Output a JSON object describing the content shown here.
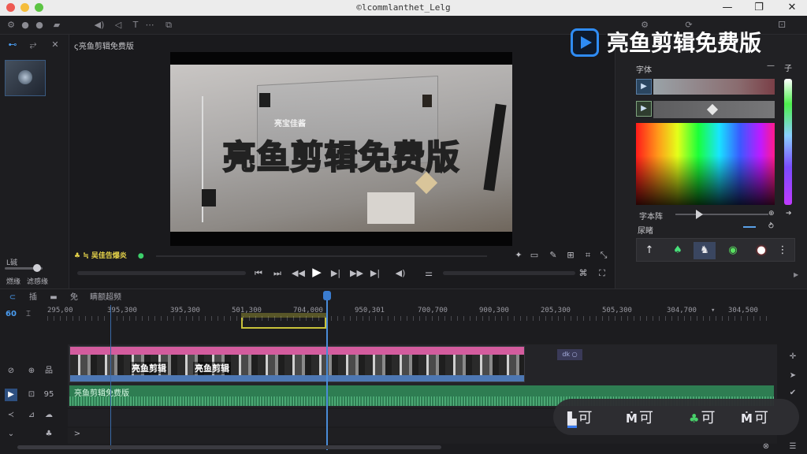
{
  "window": {
    "title": "©lcommlanthet_Lelg",
    "minimize": "—",
    "maximize": "❐",
    "close": "✕"
  },
  "brand": {
    "name": "亮鱼剪辑免费版"
  },
  "left_panel": {
    "tabs": [
      "⊷",
      "⥂",
      "✕"
    ],
    "label_1": "L碱",
    "label_2": "燃缘",
    "label_3": "滤感缘"
  },
  "preview": {
    "title": "ς亮鱼剪辑免费版",
    "caption": "亮鱼剪辑免费版",
    "board_text": "亮宝佳酱",
    "tags": "♣ ≒ 吴佳告爆炎",
    "controls": {
      "first": "⏮",
      "prev": "⏭",
      "rewind": "◀◀",
      "play": "▶",
      "next": "▶|",
      "fforward": "▶▶",
      "last": "▶|",
      "volume": "◀)",
      "settings": "⚌"
    }
  },
  "right_panel": {
    "font_label": "字体",
    "font_dash": "—",
    "font_icon": "子",
    "size_label": "字本阵",
    "style_label": "尿睹",
    "style_value": "─",
    "btn1": "▶",
    "btn2": "▶",
    "shapes": [
      "↑",
      "♠",
      "♞",
      "◉",
      "●",
      "⋮"
    ]
  },
  "timeline": {
    "toolbar": [
      "⊂",
      "插",
      "▬",
      "免",
      "瞒额超频"
    ],
    "zoom": "60",
    "ticks": [
      "295,00",
      "395,300",
      "395,300",
      "501,300",
      "704,000",
      "950,301",
      "700,700",
      "900,300",
      "205,300",
      "505,300",
      "304,700",
      "▾",
      "304,500"
    ],
    "video_clip_labels": [
      "亮鱼剪辑",
      "亮鱼剪辑"
    ],
    "small_clip": "dk ○",
    "audio_label": "亮鱼剪辑免费版",
    "track_icons": {
      "video": [
        "⊘",
        "⊕",
        "品"
      ],
      "audio": [
        "▶",
        "⊡",
        "95"
      ],
      "fx": [
        "≺",
        "⊿",
        "☁"
      ],
      "extra": [
        "⌄",
        "♣",
        ">"
      ]
    }
  },
  "pill": {
    "items": [
      {
        "glyph": "▙",
        "text": "可"
      },
      {
        "glyph": "Ṁ",
        "text": "可"
      },
      {
        "glyph": "♣",
        "text": "可"
      },
      {
        "glyph": "Ṁ",
        "text": "可"
      }
    ]
  }
}
